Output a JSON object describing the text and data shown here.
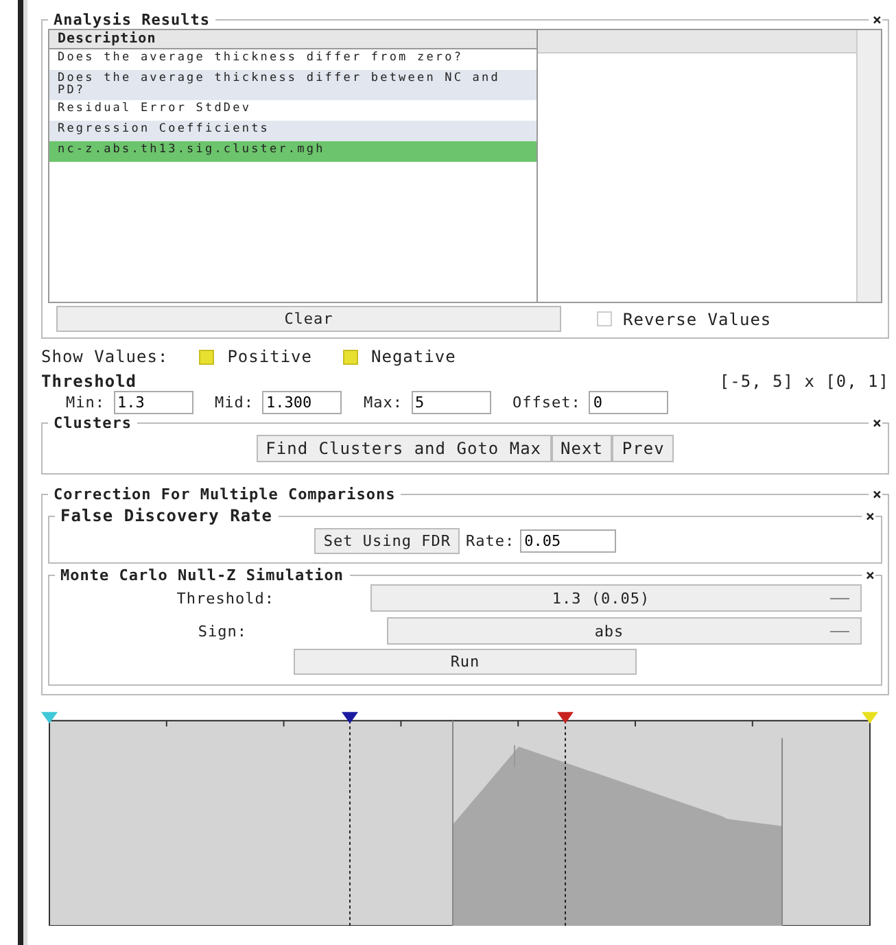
{
  "analysis_results": {
    "title": "Analysis Results",
    "close": "×",
    "column": "Description",
    "rows": [
      {
        "text": "Does the average thickness differ from zero?",
        "selected": false
      },
      {
        "text": "Does the average thickness differ between NC and PD?",
        "selected": false
      },
      {
        "text": "Residual Error StdDev",
        "selected": false
      },
      {
        "text": "Regression Coefficients",
        "selected": false
      },
      {
        "text": "nc-z.abs.th13.sig.cluster.mgh",
        "selected": true
      }
    ],
    "clear_button": "Clear",
    "reverse_values": {
      "label": "Reverse Values",
      "checked": false
    }
  },
  "show_values": {
    "label": "Show Values:",
    "options": [
      {
        "label": "Positive",
        "checked": true
      },
      {
        "label": "Negative",
        "checked": true
      }
    ]
  },
  "threshold": {
    "title": "Threshold",
    "range": "[-5, 5] x [0, 1]",
    "fields": [
      {
        "label": "Min:",
        "value": "1.3"
      },
      {
        "label": "Mid:",
        "value": "1.300"
      },
      {
        "label": "Max:",
        "value": "5"
      },
      {
        "label": "Offset:",
        "value": "0"
      }
    ]
  },
  "clusters": {
    "title": "Clusters",
    "close": "×",
    "buttons": [
      "Find Clusters and Goto Max",
      "Next",
      "Prev"
    ]
  },
  "correction": {
    "title": "Correction For Multiple Comparisons",
    "close": "×",
    "fdr": {
      "title": "False Discovery Rate",
      "close": "×",
      "button": "Set Using FDR",
      "rate_label": "Rate:",
      "rate": "0.05"
    },
    "monte_carlo": {
      "title": "Monte Carlo Null-Z Simulation",
      "close": "×",
      "threshold_label": "Threshold:",
      "threshold": "1.3 (0.05)",
      "sign_label": "Sign:",
      "sign": "abs",
      "run": "Run"
    }
  }
}
